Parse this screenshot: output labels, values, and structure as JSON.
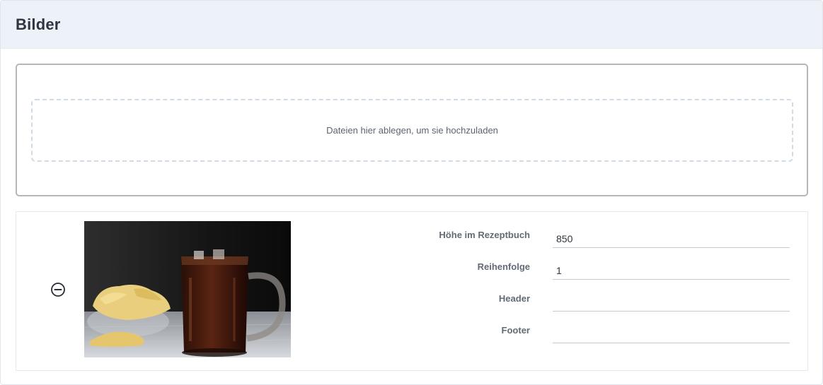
{
  "header": {
    "title": "Bilder"
  },
  "upload": {
    "dropzone_text": "Dateien hier ablegen, um sie hochzuladen"
  },
  "image_item": {
    "remove_icon": "minus-circle-icon",
    "image_alt": "",
    "fields": {
      "height": {
        "label": "Höhe im Rezeptbuch",
        "value": "850"
      },
      "order": {
        "label": "Reihenfolge",
        "value": "1"
      },
      "header": {
        "label": "Header",
        "value": ""
      },
      "footer": {
        "label": "Footer",
        "value": ""
      }
    }
  },
  "colors": {
    "header_bg": "#edf1f8",
    "title_text": "#2f3440",
    "label_text": "#626a76",
    "dropzone_border": "#d1dbe6",
    "upload_border": "#b4b6ba"
  }
}
